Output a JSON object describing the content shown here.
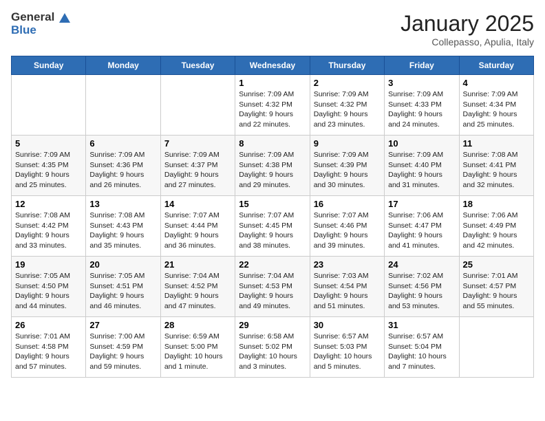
{
  "header": {
    "logo_general": "General",
    "logo_blue": "Blue",
    "month": "January 2025",
    "location": "Collepasso, Apulia, Italy"
  },
  "days": [
    "Sunday",
    "Monday",
    "Tuesday",
    "Wednesday",
    "Thursday",
    "Friday",
    "Saturday"
  ],
  "weeks": [
    [
      {
        "date": "",
        "sunrise": "",
        "sunset": "",
        "daylight": ""
      },
      {
        "date": "",
        "sunrise": "",
        "sunset": "",
        "daylight": ""
      },
      {
        "date": "",
        "sunrise": "",
        "sunset": "",
        "daylight": ""
      },
      {
        "date": "1",
        "sunrise": "7:09 AM",
        "sunset": "4:32 PM",
        "daylight": "9 hours and 22 minutes."
      },
      {
        "date": "2",
        "sunrise": "7:09 AM",
        "sunset": "4:32 PM",
        "daylight": "9 hours and 23 minutes."
      },
      {
        "date": "3",
        "sunrise": "7:09 AM",
        "sunset": "4:33 PM",
        "daylight": "9 hours and 24 minutes."
      },
      {
        "date": "4",
        "sunrise": "7:09 AM",
        "sunset": "4:34 PM",
        "daylight": "9 hours and 25 minutes."
      }
    ],
    [
      {
        "date": "5",
        "sunrise": "7:09 AM",
        "sunset": "4:35 PM",
        "daylight": "9 hours and 25 minutes."
      },
      {
        "date": "6",
        "sunrise": "7:09 AM",
        "sunset": "4:36 PM",
        "daylight": "9 hours and 26 minutes."
      },
      {
        "date": "7",
        "sunrise": "7:09 AM",
        "sunset": "4:37 PM",
        "daylight": "9 hours and 27 minutes."
      },
      {
        "date": "8",
        "sunrise": "7:09 AM",
        "sunset": "4:38 PM",
        "daylight": "9 hours and 29 minutes."
      },
      {
        "date": "9",
        "sunrise": "7:09 AM",
        "sunset": "4:39 PM",
        "daylight": "9 hours and 30 minutes."
      },
      {
        "date": "10",
        "sunrise": "7:09 AM",
        "sunset": "4:40 PM",
        "daylight": "9 hours and 31 minutes."
      },
      {
        "date": "11",
        "sunrise": "7:08 AM",
        "sunset": "4:41 PM",
        "daylight": "9 hours and 32 minutes."
      }
    ],
    [
      {
        "date": "12",
        "sunrise": "7:08 AM",
        "sunset": "4:42 PM",
        "daylight": "9 hours and 33 minutes."
      },
      {
        "date": "13",
        "sunrise": "7:08 AM",
        "sunset": "4:43 PM",
        "daylight": "9 hours and 35 minutes."
      },
      {
        "date": "14",
        "sunrise": "7:07 AM",
        "sunset": "4:44 PM",
        "daylight": "9 hours and 36 minutes."
      },
      {
        "date": "15",
        "sunrise": "7:07 AM",
        "sunset": "4:45 PM",
        "daylight": "9 hours and 38 minutes."
      },
      {
        "date": "16",
        "sunrise": "7:07 AM",
        "sunset": "4:46 PM",
        "daylight": "9 hours and 39 minutes."
      },
      {
        "date": "17",
        "sunrise": "7:06 AM",
        "sunset": "4:47 PM",
        "daylight": "9 hours and 41 minutes."
      },
      {
        "date": "18",
        "sunrise": "7:06 AM",
        "sunset": "4:49 PM",
        "daylight": "9 hours and 42 minutes."
      }
    ],
    [
      {
        "date": "19",
        "sunrise": "7:05 AM",
        "sunset": "4:50 PM",
        "daylight": "9 hours and 44 minutes."
      },
      {
        "date": "20",
        "sunrise": "7:05 AM",
        "sunset": "4:51 PM",
        "daylight": "9 hours and 46 minutes."
      },
      {
        "date": "21",
        "sunrise": "7:04 AM",
        "sunset": "4:52 PM",
        "daylight": "9 hours and 47 minutes."
      },
      {
        "date": "22",
        "sunrise": "7:04 AM",
        "sunset": "4:53 PM",
        "daylight": "9 hours and 49 minutes."
      },
      {
        "date": "23",
        "sunrise": "7:03 AM",
        "sunset": "4:54 PM",
        "daylight": "9 hours and 51 minutes."
      },
      {
        "date": "24",
        "sunrise": "7:02 AM",
        "sunset": "4:56 PM",
        "daylight": "9 hours and 53 minutes."
      },
      {
        "date": "25",
        "sunrise": "7:01 AM",
        "sunset": "4:57 PM",
        "daylight": "9 hours and 55 minutes."
      }
    ],
    [
      {
        "date": "26",
        "sunrise": "7:01 AM",
        "sunset": "4:58 PM",
        "daylight": "9 hours and 57 minutes."
      },
      {
        "date": "27",
        "sunrise": "7:00 AM",
        "sunset": "4:59 PM",
        "daylight": "9 hours and 59 minutes."
      },
      {
        "date": "28",
        "sunrise": "6:59 AM",
        "sunset": "5:00 PM",
        "daylight": "10 hours and 1 minute."
      },
      {
        "date": "29",
        "sunrise": "6:58 AM",
        "sunset": "5:02 PM",
        "daylight": "10 hours and 3 minutes."
      },
      {
        "date": "30",
        "sunrise": "6:57 AM",
        "sunset": "5:03 PM",
        "daylight": "10 hours and 5 minutes."
      },
      {
        "date": "31",
        "sunrise": "6:57 AM",
        "sunset": "5:04 PM",
        "daylight": "10 hours and 7 minutes."
      },
      {
        "date": "",
        "sunrise": "",
        "sunset": "",
        "daylight": ""
      }
    ]
  ]
}
